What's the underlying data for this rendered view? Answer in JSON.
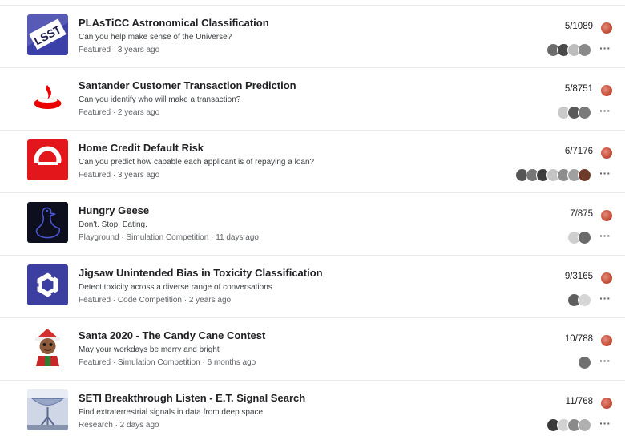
{
  "competitions": [
    {
      "title": "PLAsTiCC Astronomical Classification",
      "description": "Can you help make sense of the Universe?",
      "meta": "Featured · 3 years ago",
      "rank": "5/1089",
      "thumb_icon": "lsst-logo-icon",
      "avatar_colors": [
        "#6b6b6b",
        "#4a4a4a",
        "#bdbdbd",
        "#8a8a8a"
      ],
      "more_label": "···"
    },
    {
      "title": "Santander Customer Transaction Prediction",
      "description": "Can you identify who will make a transaction?",
      "meta": "Featured · 2 years ago",
      "rank": "5/8751",
      "thumb_icon": "santander-flame-icon",
      "avatar_colors": [
        "#c9c9c9",
        "#5a5a5a",
        "#7a7a7a"
      ],
      "more_label": "···"
    },
    {
      "title": "Home Credit Default Risk",
      "description": "Can you predict how capable each applicant is of repaying a loan?",
      "meta": "Featured · 3 years ago",
      "rank": "6/7176",
      "thumb_icon": "home-credit-logo-icon",
      "avatar_colors": [
        "#555555",
        "#777777",
        "#3d3d3d",
        "#c4c4c4",
        "#8d8d8d",
        "#a0a0a0",
        "#6e3b2b"
      ],
      "more_label": "···"
    },
    {
      "title": "Hungry Geese",
      "description": "Don't. Stop. Eating.",
      "meta": "Playground · Simulation Competition · 11 days ago",
      "rank": "7/875",
      "thumb_icon": "goose-icon",
      "avatar_colors": [
        "#cfcfcf",
        "#6a6a6a"
      ],
      "more_label": "···"
    },
    {
      "title": "Jigsaw Unintended Bias in Toxicity Classification",
      "description": "Detect toxicity across a diverse range of conversations",
      "meta": "Featured · Code Competition · 2 years ago",
      "rank": "9/3165",
      "thumb_icon": "jigsaw-logo-icon",
      "avatar_colors": [
        "#5e5e5e",
        "#d6d6d6"
      ],
      "more_label": "···"
    },
    {
      "title": "Santa 2020 - The Candy Cane Contest",
      "description": "May your workdays be merry and bright",
      "meta": "Featured · Simulation Competition · 6 months ago",
      "rank": "10/788",
      "thumb_icon": "elf-icon",
      "avatar_colors": [
        "#707070"
      ],
      "more_label": "···"
    },
    {
      "title": "SETI Breakthrough Listen - E.T. Signal Search",
      "description": "Find extraterrestrial signals in data from deep space",
      "meta": "Research · 2 days ago",
      "rank": "11/768",
      "thumb_icon": "seti-dish-icon",
      "avatar_colors": [
        "#3a3a3a",
        "#d2d2d2",
        "#8a8a8a",
        "#b0b0b0"
      ],
      "more_label": "···"
    }
  ],
  "accent": {
    "medal": "#c44e3a",
    "divider": "#e8eaed"
  }
}
